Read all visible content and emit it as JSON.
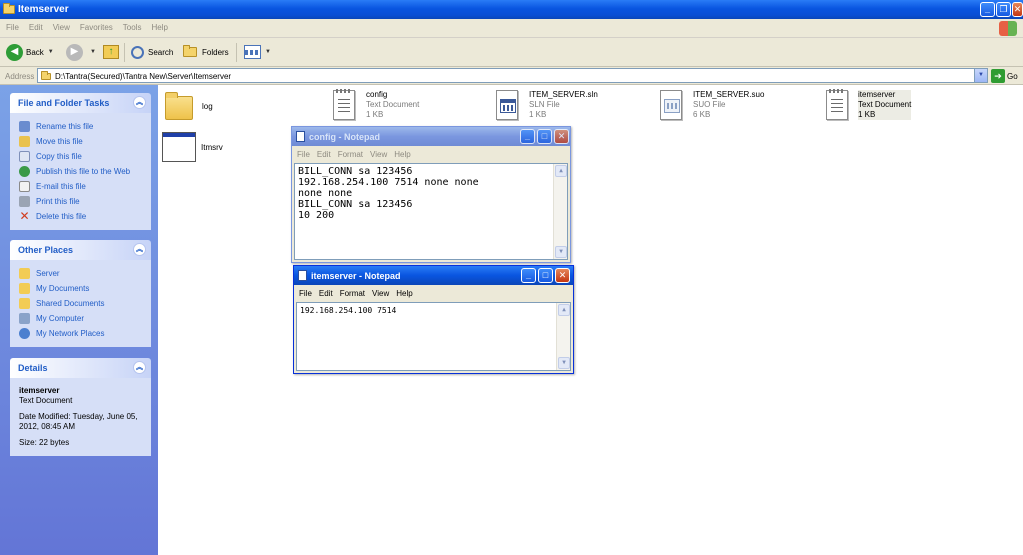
{
  "window": {
    "title": "Itemserver"
  },
  "menu": [
    "File",
    "Edit",
    "View",
    "Favorites",
    "Tools",
    "Help"
  ],
  "toolbar": {
    "back": "Back",
    "search": "Search",
    "folders": "Folders"
  },
  "address": {
    "label": "Address",
    "path": "D:\\Tantra(Secured)\\Tantra New\\Server\\Itemserver",
    "go": "Go"
  },
  "tasks": {
    "heading": "File and Folder Tasks",
    "items": [
      "Rename this file",
      "Move this file",
      "Copy this file",
      "Publish this file to the Web",
      "E-mail this file",
      "Print this file",
      "Delete this file"
    ]
  },
  "places": {
    "heading": "Other Places",
    "items": [
      "Server",
      "My Documents",
      "Shared Documents",
      "My Computer",
      "My Network Places"
    ]
  },
  "details": {
    "heading": "Details",
    "name": "itemserver",
    "type": "Text Document",
    "modified": "Date Modified: Tuesday, June 05, 2012, 08:45 AM",
    "size": "Size: 22 bytes"
  },
  "files": [
    {
      "name": "log"
    },
    {
      "name": "config",
      "type": "Text Document",
      "size": "1 KB"
    },
    {
      "name": "ITEM_SERVER.sln",
      "type": "SLN File",
      "size": "1 KB"
    },
    {
      "name": "ITEM_SERVER.suo",
      "type": "SUO File",
      "size": "6 KB"
    },
    {
      "name": "itemserver",
      "type": "Text Document",
      "size": "1 KB"
    },
    {
      "name": "Itmsrv"
    }
  ],
  "notepad_config": {
    "title": "config - Notepad",
    "menu": [
      "File",
      "Edit",
      "Format",
      "View",
      "Help"
    ],
    "content": "BILL_CONN sa 123456\n192.168.254.100 7514 none none\nnone none\nBILL_CONN sa 123456\n10 200"
  },
  "notepad_itemserver": {
    "title": "itemserver - Notepad",
    "menu": [
      "File",
      "Edit",
      "Format",
      "View",
      "Help"
    ],
    "content": "192.168.254.100 7514"
  }
}
